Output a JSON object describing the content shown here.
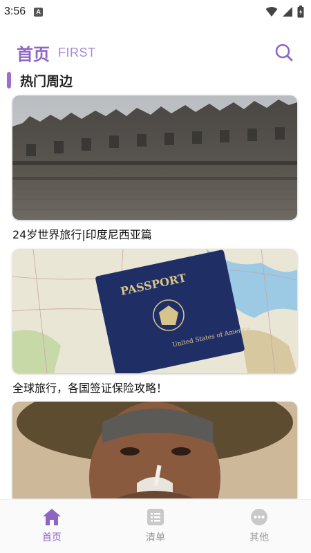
{
  "status_bar": {
    "time": "3:56",
    "notification_badge": "A"
  },
  "header": {
    "title": "首页",
    "subtitle": "FIRST",
    "search_icon": "search-icon"
  },
  "section": {
    "title": "热门周边"
  },
  "cards": [
    {
      "title": "24岁世界旅行|印度尼西亚篇",
      "image": "borobudur-temple-photo"
    },
    {
      "title": "全球旅行，各国签证保险攻略！",
      "image": "passport-on-map-photo",
      "passport_text": "PASSPORT",
      "passport_country": "United States of America"
    },
    {
      "title": "",
      "image": "smoking-man-portrait-photo"
    }
  ],
  "tabs": [
    {
      "label": "首页",
      "icon": "home-icon",
      "active": true
    },
    {
      "label": "清单",
      "icon": "list-icon",
      "active": false
    },
    {
      "label": "其他",
      "icon": "more-icon",
      "active": false
    }
  ],
  "colors": {
    "accent": "#8e64c4",
    "inactive": "#9a9a9a"
  }
}
